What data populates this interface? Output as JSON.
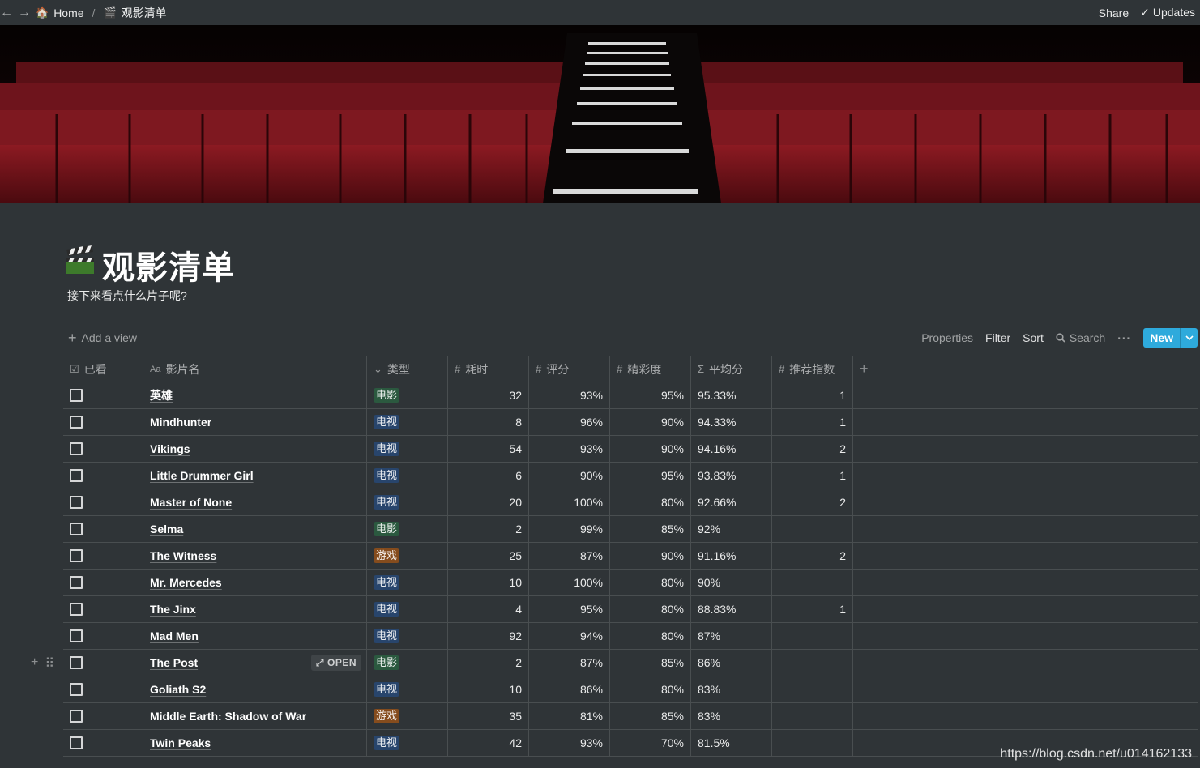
{
  "topbar": {
    "breadcrumb_home": "Home",
    "breadcrumb_separator": "/",
    "breadcrumb_page": "观影清单",
    "share_label": "Share",
    "updates_label": "Updates"
  },
  "page": {
    "title": "观影清单",
    "description": "接下来看点什么片子呢?"
  },
  "viewbar": {
    "add_view_label": "Add a view",
    "properties_label": "Properties",
    "filter_label": "Filter",
    "sort_label": "Sort",
    "search_label": "Search",
    "new_label": "New"
  },
  "table": {
    "columns": [
      "已看",
      "影片名",
      "类型",
      "耗时",
      "评分",
      "精彩度",
      "平均分",
      "推荐指数"
    ],
    "open_label": "OPEN",
    "rows": [
      {
        "name": "英雄",
        "type": "电影",
        "time": "32",
        "score": "93%",
        "excite": "95%",
        "avg": "95.33%",
        "rec": "1"
      },
      {
        "name": "Mindhunter",
        "type": "电视",
        "time": "8",
        "score": "96%",
        "excite": "90%",
        "avg": "94.33%",
        "rec": "1"
      },
      {
        "name": "Vikings",
        "type": "电视",
        "time": "54",
        "score": "93%",
        "excite": "90%",
        "avg": "94.16%",
        "rec": "2"
      },
      {
        "name": "Little Drummer Girl",
        "type": "电视",
        "time": "6",
        "score": "90%",
        "excite": "95%",
        "avg": "93.83%",
        "rec": "1"
      },
      {
        "name": "Master of None",
        "type": "电视",
        "time": "20",
        "score": "100%",
        "excite": "80%",
        "avg": "92.66%",
        "rec": "2"
      },
      {
        "name": "Selma",
        "type": "电影",
        "time": "2",
        "score": "99%",
        "excite": "85%",
        "avg": "92%",
        "rec": ""
      },
      {
        "name": "The Witness",
        "type": "游戏",
        "time": "25",
        "score": "87%",
        "excite": "90%",
        "avg": "91.16%",
        "rec": "2"
      },
      {
        "name": "Mr. Mercedes",
        "type": "电视",
        "time": "10",
        "score": "100%",
        "excite": "80%",
        "avg": "90%",
        "rec": ""
      },
      {
        "name": "The Jinx",
        "type": "电视",
        "time": "4",
        "score": "95%",
        "excite": "80%",
        "avg": "88.83%",
        "rec": "1"
      },
      {
        "name": "Mad Men",
        "type": "电视",
        "time": "92",
        "score": "94%",
        "excite": "80%",
        "avg": "87%",
        "rec": ""
      },
      {
        "name": "The Post",
        "type": "电影",
        "time": "2",
        "score": "87%",
        "excite": "85%",
        "avg": "86%",
        "rec": ""
      },
      {
        "name": "Goliath S2",
        "type": "电视",
        "time": "10",
        "score": "86%",
        "excite": "80%",
        "avg": "83%",
        "rec": ""
      },
      {
        "name": "Middle Earth: Shadow of War",
        "type": "游戏",
        "time": "35",
        "score": "81%",
        "excite": "85%",
        "avg": "83%",
        "rec": ""
      },
      {
        "name": "Twin Peaks",
        "type": "电视",
        "time": "42",
        "score": "93%",
        "excite": "70%",
        "avg": "81.5%",
        "rec": ""
      }
    ]
  },
  "colors": {
    "background": "#2f3437",
    "accent": "#2eaadc",
    "tag_movie": "#2b593f",
    "tag_tv": "#28456c",
    "tag_game": "#854c1d"
  },
  "watermark": "https://blog.csdn.net/u014162133"
}
